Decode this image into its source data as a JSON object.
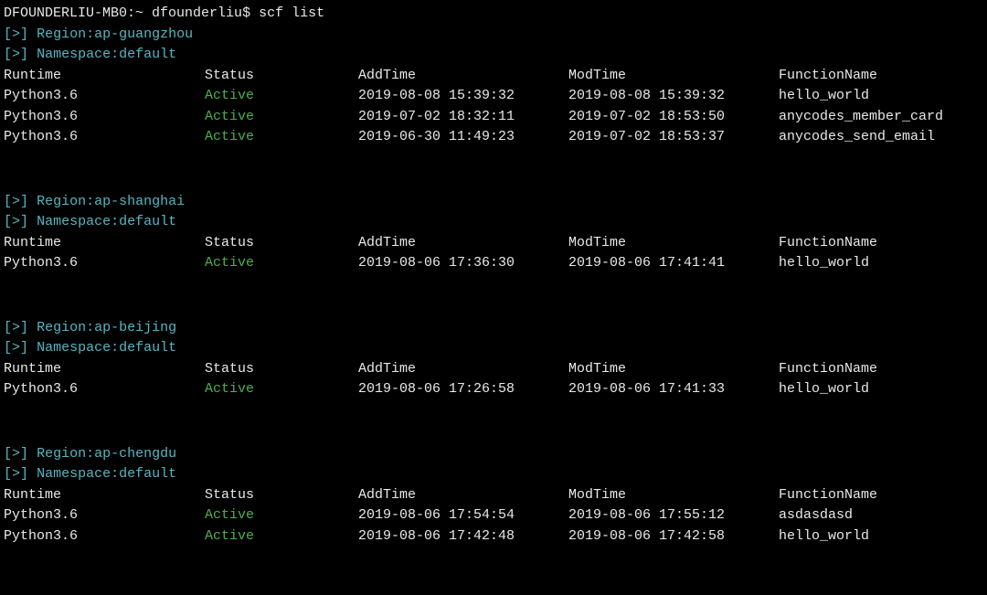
{
  "prompt": {
    "host": "DFOUNDERLIU-MB0:~",
    "user": "dfounderliu$",
    "command": "scf list"
  },
  "marker": {
    "open": "[",
    "gt": ">",
    "close": "]"
  },
  "labels": {
    "region_prefix": "Region:",
    "namespace_prefix": "Namespace:"
  },
  "headers": {
    "runtime": "Runtime",
    "status": "Status",
    "addtime": "AddTime",
    "modtime": "ModTime",
    "functionname": "FunctionName"
  },
  "sections": [
    {
      "region": "ap-guangzhou",
      "namespace": "default",
      "rows": [
        {
          "runtime": "Python3.6",
          "status": "Active",
          "addtime": "2019-08-08 15:39:32",
          "modtime": "2019-08-08 15:39:32",
          "name": "hello_world"
        },
        {
          "runtime": "Python3.6",
          "status": "Active",
          "addtime": "2019-07-02 18:32:11",
          "modtime": "2019-07-02 18:53:50",
          "name": "anycodes_member_card"
        },
        {
          "runtime": "Python3.6",
          "status": "Active",
          "addtime": "2019-06-30 11:49:23",
          "modtime": "2019-07-02 18:53:37",
          "name": "anycodes_send_email"
        }
      ]
    },
    {
      "region": "ap-shanghai",
      "namespace": "default",
      "rows": [
        {
          "runtime": "Python3.6",
          "status": "Active",
          "addtime": "2019-08-06 17:36:30",
          "modtime": "2019-08-06 17:41:41",
          "name": "hello_world"
        }
      ]
    },
    {
      "region": "ap-beijing",
      "namespace": "default",
      "rows": [
        {
          "runtime": "Python3.6",
          "status": "Active",
          "addtime": "2019-08-06 17:26:58",
          "modtime": "2019-08-06 17:41:33",
          "name": "hello_world"
        }
      ]
    },
    {
      "region": "ap-chengdu",
      "namespace": "default",
      "rows": [
        {
          "runtime": "Python3.6",
          "status": "Active",
          "addtime": "2019-08-06 17:54:54",
          "modtime": "2019-08-06 17:55:12",
          "name": "asdasdasd"
        },
        {
          "runtime": "Python3.6",
          "status": "Active",
          "addtime": "2019-08-06 17:42:48",
          "modtime": "2019-08-06 17:42:58",
          "name": "hello_world"
        }
      ]
    }
  ]
}
